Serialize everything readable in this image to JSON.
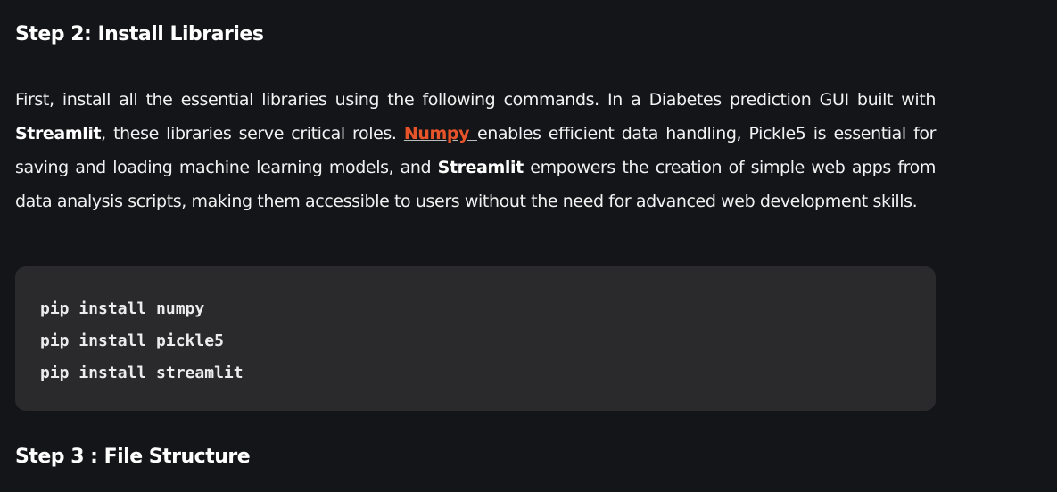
{
  "step2_title": "Step 2: Install Libraries",
  "paragraph": {
    "t1": "First, install all the essential libraries using the following commands. In a Diabetes prediction GUI built with ",
    "b1": "Streamlit",
    "t2": ", these libraries serve critical roles. ",
    "link": "Numpy ",
    "t3": "enables efficient data handling, Pickle5 is essential for saving and loading machine learning models, and ",
    "b2": "Streamlit",
    "t4": " empowers the creation of simple web apps from data analysis scripts, making them accessible to users without the need for advanced web development skills."
  },
  "code": [
    "pip install numpy",
    "pip install pickle5",
    "pip install streamlit"
  ],
  "step3_title": "Step 3 : File Structure",
  "colors": {
    "background": "#141518",
    "code_bg": "#2a2a2d",
    "link": "#e8542a"
  }
}
